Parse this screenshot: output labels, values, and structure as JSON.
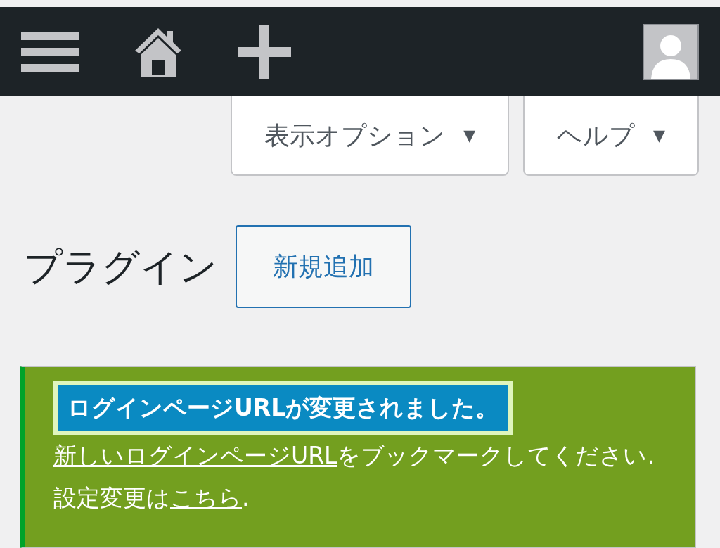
{
  "toolbar": {
    "buttons": [
      {
        "label": "表示オプション",
        "caret": "▼"
      },
      {
        "label": "ヘルプ",
        "caret": "▼"
      }
    ]
  },
  "page": {
    "title": "プラグイン",
    "add_button": "新規追加"
  },
  "notice": {
    "highlight": "ログインページURLが変更されました。",
    "parts": [
      {
        "kind": "link",
        "text": "新しいログインページURL"
      },
      {
        "kind": "text",
        "text": "をブックマークしてください. 設定変更は"
      },
      {
        "kind": "link",
        "text": "こちら"
      },
      {
        "kind": "text",
        "text": "."
      }
    ]
  }
}
